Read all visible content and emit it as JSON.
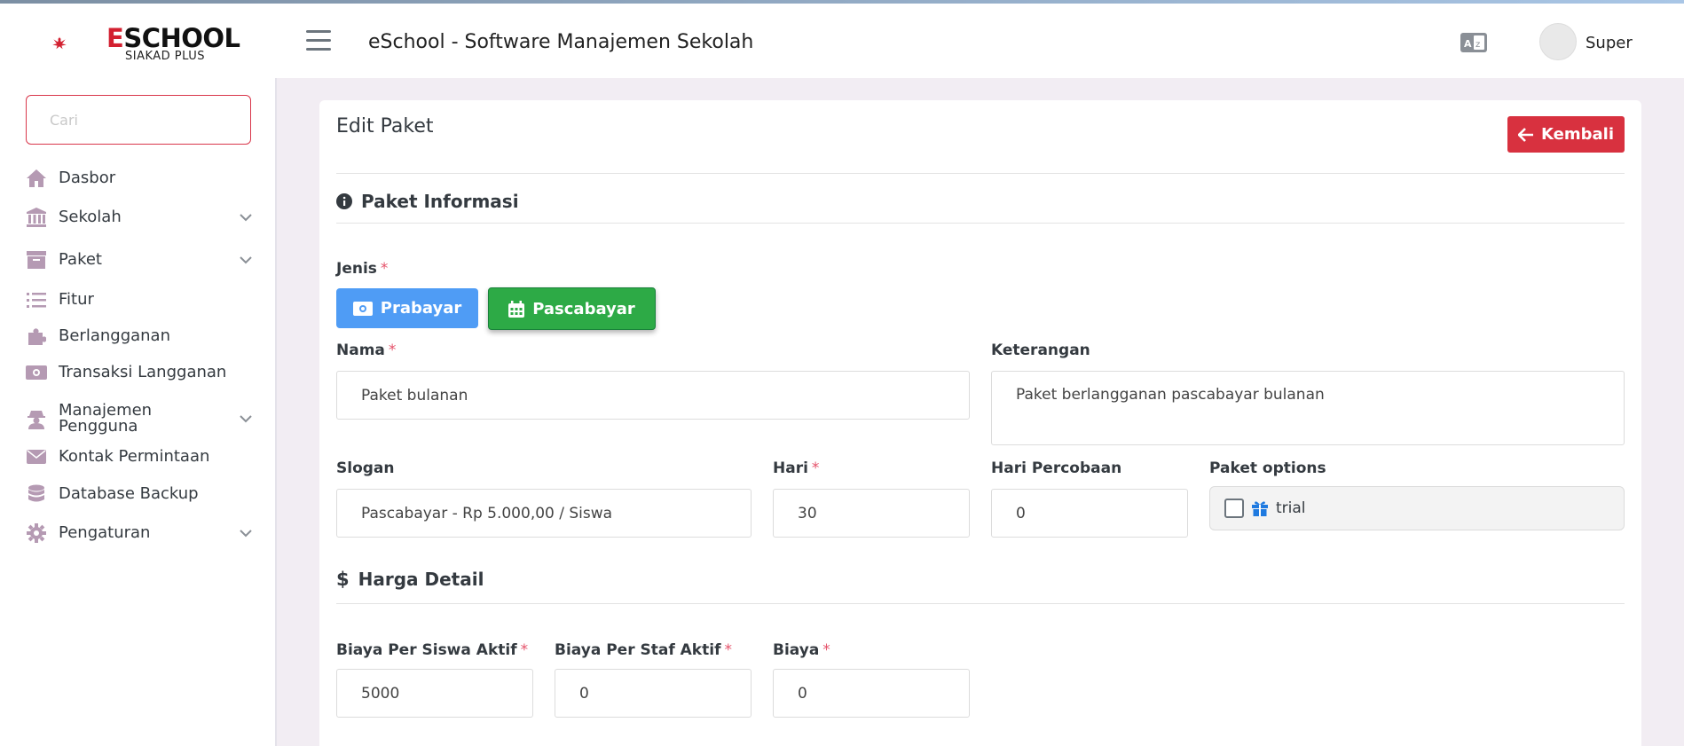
{
  "brand": {
    "logo_text": "ESCHOOL",
    "logo_sub": "SIAKAD PLUS"
  },
  "header": {
    "title": "eSchool - Software Manajemen Sekolah",
    "user_name": "Super"
  },
  "sidebar": {
    "search_placeholder": "Cari",
    "items": [
      {
        "label": "Dasbor",
        "icon": "home-icon",
        "has_children": false
      },
      {
        "label": "Sekolah",
        "icon": "school-icon",
        "has_children": true
      },
      {
        "label": "Paket",
        "icon": "archive-icon",
        "has_children": true
      },
      {
        "label": "Fitur",
        "icon": "list-icon",
        "has_children": false
      },
      {
        "label": "Berlangganan",
        "icon": "puzzle-icon",
        "has_children": false
      },
      {
        "label": "Transaksi Langganan",
        "icon": "money-icon",
        "has_children": false
      },
      {
        "label": "Manajemen Pengguna",
        "icon": "user-secret-icon",
        "has_children": true
      },
      {
        "label": "Kontak Permintaan",
        "icon": "envelope-icon",
        "has_children": false
      },
      {
        "label": "Database Backup",
        "icon": "database-icon",
        "has_children": false
      },
      {
        "label": "Pengaturan",
        "icon": "gear-icon",
        "has_children": true
      }
    ]
  },
  "page": {
    "title": "Edit Paket",
    "back_label": "Kembali",
    "section_info": "Paket Informasi",
    "section_price": "Harga Detail",
    "jenis_label": "Jenis",
    "jenis_options": [
      "Prabayar",
      "Pascabayar"
    ],
    "jenis_selected": "Pascabayar",
    "nama_label": "Nama",
    "nama_value": "Paket bulanan",
    "keterangan_label": "Keterangan",
    "keterangan_value": "Paket berlangganan pascabayar bulanan",
    "slogan_label": "Slogan",
    "slogan_value": "Pascabayar - Rp 5.000,00 / Siswa",
    "hari_label": "Hari",
    "hari_value": "30",
    "hari_percobaan_label": "Hari Percobaan",
    "hari_percobaan_value": "0",
    "paket_options_label": "Paket options",
    "trial_label": "trial",
    "trial_checked": false,
    "biaya_siswa_label": "Biaya Per Siswa Aktif",
    "biaya_siswa_value": "5000",
    "biaya_staf_label": "Biaya Per Staf Aktif",
    "biaya_staf_value": "0",
    "biaya_label": "Biaya",
    "biaya_value": "0",
    "required_mark": "*"
  },
  "colors": {
    "accent_red": "#d8313f",
    "prabayar_blue": "#4f9cf5",
    "pascabayar_green": "#2daa46",
    "sidebar_icon": "#b59ab3"
  }
}
